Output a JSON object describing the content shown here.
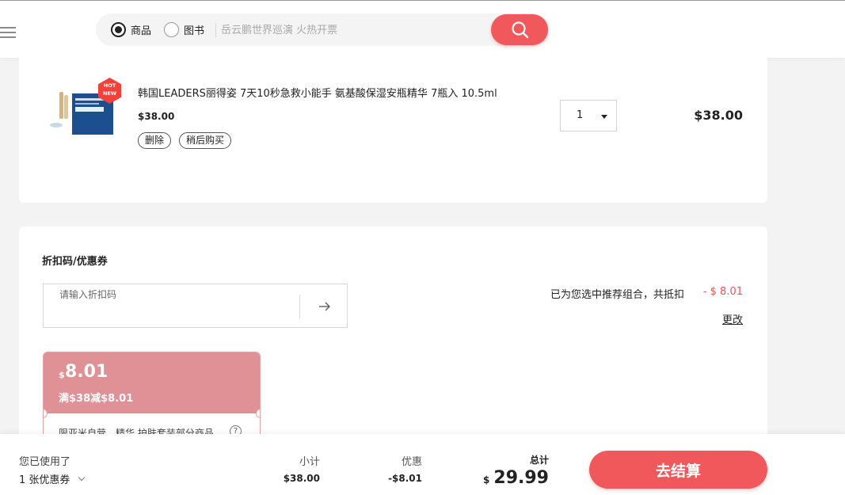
{
  "header": {
    "radio_options": [
      {
        "label": "商品",
        "checked": true
      },
      {
        "label": "图书",
        "checked": false
      }
    ],
    "search_placeholder": "岳云鹏世界巡演 火热开票",
    "accent_color": "#f0585b"
  },
  "cart_item": {
    "badge_top": "HOT",
    "badge_bottom": "NEW",
    "title": "韩国LEADERS丽得姿 7天10秒急救小能手 氨基酸保湿安瓶精华 7瓶入 10.5ml",
    "price": "$38.00",
    "delete_label": "删除",
    "later_label": "稍后购买",
    "quantity": "1",
    "line_total": "$38.00"
  },
  "coupon_section": {
    "title": "折扣码/优惠券",
    "code_placeholder": "请输入折扣码",
    "recommend_text": "已为您选中推荐组合，共抵扣",
    "recommend_discount": "- $ 8.01",
    "change_label": "更改",
    "coupon": {
      "currency": "$",
      "amount": "8.01",
      "condition": "满$38减$8.01",
      "scope": "限亚米自营，精华,护肤套装部分商品",
      "help_glyph": "?",
      "color": "#df9195"
    }
  },
  "summary": {
    "used_label": "您已使用了",
    "used_count": "1 张优惠券",
    "subtotal_label": "小计",
    "subtotal_value": "$38.00",
    "discount_label": "优惠",
    "discount_value": "-$8.01",
    "total_label": "总计",
    "total_currency": "$",
    "total_value": "29.99",
    "checkout_label": "去结算"
  }
}
